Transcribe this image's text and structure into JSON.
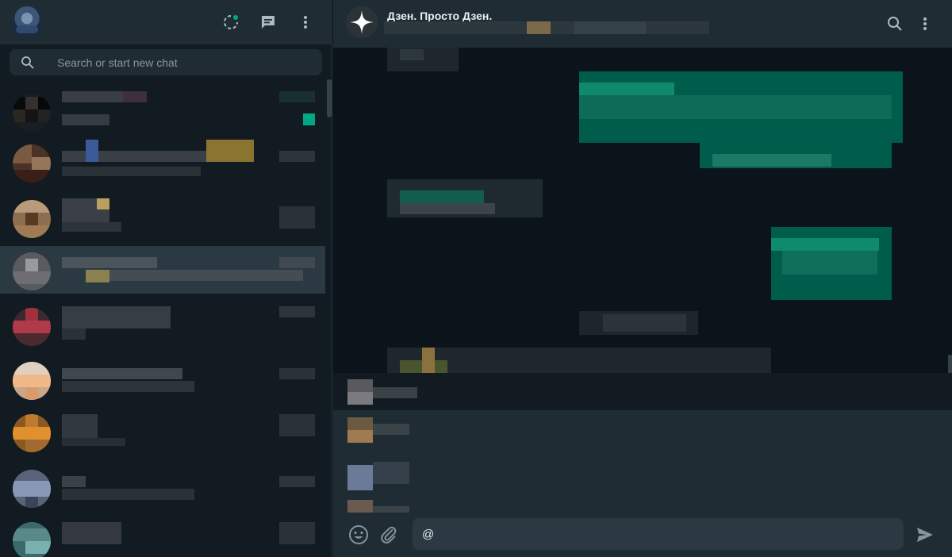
{
  "left_panel": {
    "header": {
      "icons": [
        "avatar",
        "status-icon",
        "new-chat-icon",
        "menu-icon"
      ],
      "status_dot_color": "#00a884"
    },
    "search": {
      "placeholder": "Search or start new chat",
      "value": ""
    }
  },
  "chat": {
    "title": "Дзен. Просто Дзен.",
    "header_icons": [
      "search-icon",
      "menu-icon"
    ]
  },
  "composer": {
    "value": "@",
    "icons": [
      "emoji-icon",
      "attach-icon",
      "send-icon"
    ]
  },
  "colors": {
    "panel": "#111b21",
    "header": "#202c33",
    "outgoing_bubble": "#005c4b",
    "accent": "#00a884",
    "selected_row": "#2a3942"
  }
}
